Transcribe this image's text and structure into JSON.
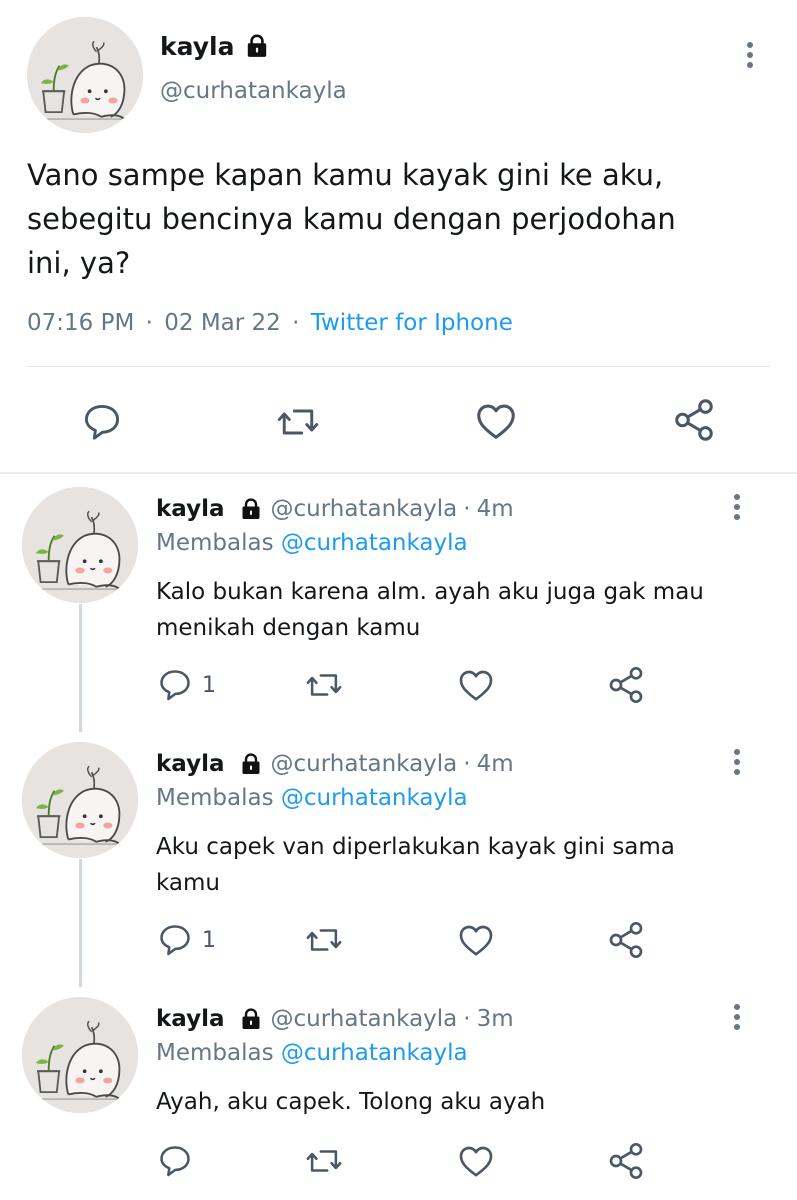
{
  "main_tweet": {
    "name": "kayla",
    "handle": "@curhatankayla",
    "text_line1": "Vano sampe kapan kamu kayak gini ke aku,",
    "text_line2": "sebegitu bencinya kamu dengan perjodohan",
    "text_line3": "ini, ya?",
    "time": "07:16 PM",
    "separator": "·",
    "date": "02 Mar 22",
    "source": "Twitter for Iphone"
  },
  "replies": [
    {
      "name": "kayla",
      "handle": "@curhatankayla",
      "dot": "·",
      "age": "4m",
      "replying_label": "Membalas",
      "replying_to": "@curhatankayla",
      "text_line1": "Kalo bukan karena alm. ayah aku juga gak mau",
      "text_line2": "menikah dengan kamu",
      "reply_count": "1"
    },
    {
      "name": "kayla",
      "handle": "@curhatankayla",
      "dot": "·",
      "age": "4m",
      "replying_label": "Membalas",
      "replying_to": "@curhatankayla",
      "text_line1": "Aku capek van diperlakukan kayak gini sama",
      "text_line2": "kamu",
      "reply_count": "1"
    },
    {
      "name": "kayla",
      "handle": "@curhatankayla",
      "dot": "·",
      "age": "3m",
      "replying_label": "Membalas",
      "replying_to": "@curhatankayla",
      "text_line1": "Ayah, aku capek. Tolong aku ayah",
      "text_line2": "",
      "reply_count": ""
    }
  ],
  "icons": {
    "reply": "speech-bubble-icon",
    "retweet": "retweet-icon",
    "like": "heart-icon",
    "share": "share-icon",
    "lock": "lock-icon",
    "more": "kebab-menu-icon"
  },
  "colors": {
    "text": "#14171a",
    "secondary": "#657786",
    "link": "#1d9bf0",
    "divider": "#e1e8ed"
  }
}
